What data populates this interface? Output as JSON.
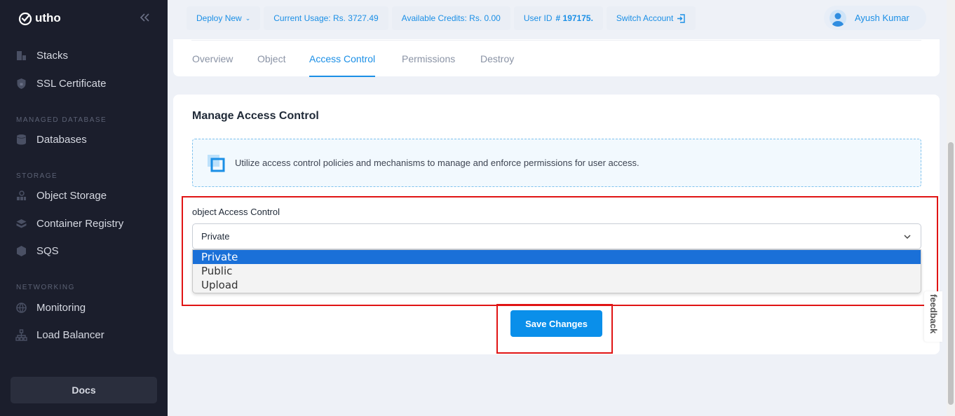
{
  "brand": {
    "name": "utho"
  },
  "sidebar": {
    "top_items": [
      {
        "label": "Stacks",
        "icon": "stacks-icon"
      },
      {
        "label": "SSL Certificate",
        "icon": "lock-icon"
      }
    ],
    "sections": [
      {
        "label": "MANAGED DATABASE",
        "items": [
          {
            "label": "Databases",
            "icon": "database-icon"
          }
        ]
      },
      {
        "label": "STORAGE",
        "items": [
          {
            "label": "Object Storage",
            "icon": "object-storage-icon"
          },
          {
            "label": "Container Registry",
            "icon": "container-icon"
          },
          {
            "label": "SQS",
            "icon": "queue-icon"
          }
        ]
      },
      {
        "label": "NETWORKING",
        "items": [
          {
            "label": "Monitoring",
            "icon": "globe-icon"
          },
          {
            "label": "Load Balancer",
            "icon": "network-icon"
          }
        ]
      }
    ],
    "docs_label": "Docs"
  },
  "topbar": {
    "deploy": "Deploy New",
    "usage": "Current Usage: Rs. 3727.49",
    "credits": "Available Credits: Rs. 0.00",
    "user_id_label": "User ID",
    "user_id_value": "# 197175.",
    "switch": "Switch Account",
    "user_name": "Ayush Kumar"
  },
  "tabs": [
    "Overview",
    "Object",
    "Access Control",
    "Permissions",
    "Destroy"
  ],
  "active_tab": "Access Control",
  "main": {
    "title": "Manage Access Control",
    "info": "Utilize access control policies and mechanisms to manage and enforce permissions for user access.",
    "field_label": "object Access Control",
    "selected": "Private",
    "options": [
      "Private",
      "Public",
      "Upload"
    ],
    "save_label": "Save Changes"
  },
  "feedback_label": "feedback",
  "colors": {
    "accent": "#0a8fea",
    "sidebar_bg": "#1b1e2c",
    "highlight": "#e01414"
  }
}
